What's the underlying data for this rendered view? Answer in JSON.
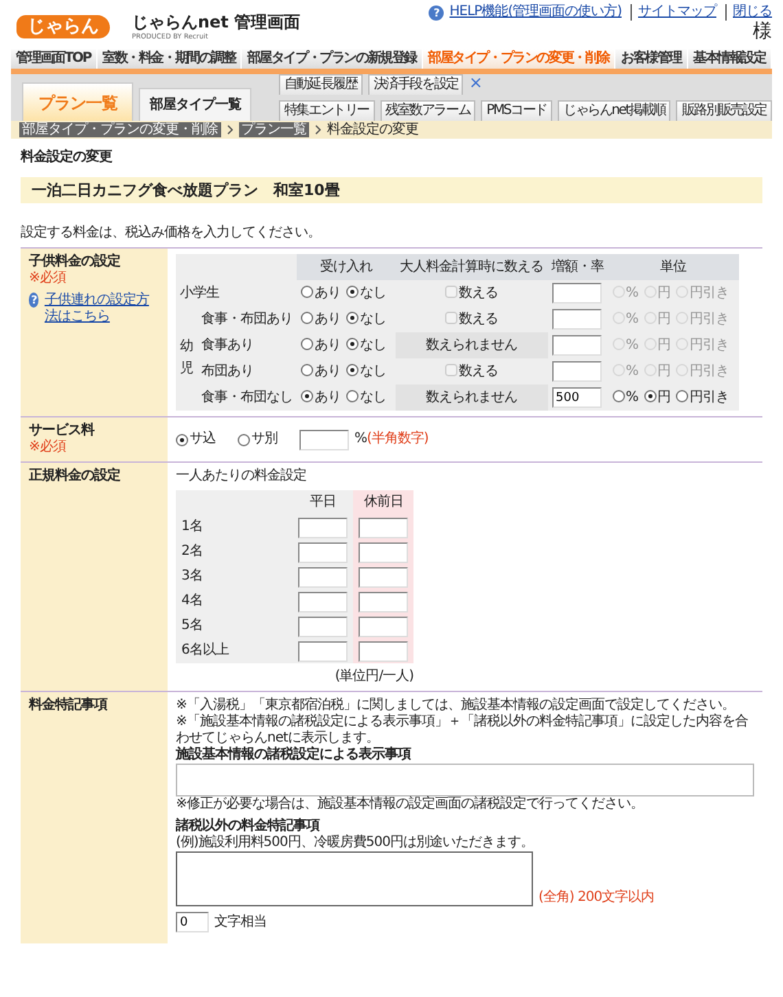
{
  "header": {
    "logo": "じゃらん",
    "title": "じゃらんnet 管理画面",
    "produced_by": "PRODUCED BY Recruit",
    "help_icon": "?",
    "links": [
      "HELP機能(管理画面の使い方)",
      "サイトマップ",
      "閉じる"
    ],
    "user_suffix": "様"
  },
  "main_nav": [
    {
      "label": "管理画面TOP",
      "selected": false
    },
    {
      "label": "室数・料金・期間の調整",
      "selected": false
    },
    {
      "label": "部屋タイプ・プランの新規登録",
      "selected": false
    },
    {
      "label": "部屋タイプ・プランの変更・削除",
      "selected": true
    },
    {
      "label": "お客様管理",
      "selected": false
    },
    {
      "label": "基本情報設定",
      "selected": false
    }
  ],
  "sub_tabs": [
    {
      "label": "プラン一覧",
      "selected": true
    },
    {
      "label": "部屋タイプ一覧",
      "selected": false
    }
  ],
  "sub_buttons_top": [
    "自動延長履歴",
    "決済手段を設定"
  ],
  "sub_close": "×",
  "sub_buttons_bottom": [
    "特集エントリー",
    "残室数アラーム",
    "PMSコード",
    "じゃらんnet掲載順",
    "販路別販売設定"
  ],
  "breadcrumb": [
    {
      "label": "部屋タイプ・プランの変更・削除",
      "kind": "link"
    },
    {
      "label": "プラン一覧",
      "kind": "link"
    },
    {
      "label": "料金設定の変更",
      "kind": "current"
    }
  ],
  "page_heading": "料金設定の変更",
  "plan_name": "一泊二日カニフグ食べ放題プラン　和室10畳",
  "tax_note": "設定する料金は、税込み価格を入力してください。",
  "child_fee": {
    "label": "子供料金の設定",
    "required": "※必須",
    "help_link": "子供連れの設定方法はこちら",
    "columns": [
      "受け入れ",
      "大人料金計算時に数える",
      "増額・率",
      "単位"
    ],
    "rows": [
      {
        "kind": "row",
        "label": "小学生",
        "accept": [
          {
            "label": "あり",
            "selected": false
          },
          {
            "label": "なし",
            "selected": true
          }
        ],
        "count": {
          "kind": "checkbox",
          "label": "数える",
          "checked": false
        },
        "units_disabled": true,
        "units": [
          {
            "label": "%",
            "selected": false
          },
          {
            "label": "円",
            "selected": false
          },
          {
            "label": "円引き",
            "selected": false
          }
        ]
      },
      {
        "kind": "group",
        "label": "幼児",
        "children": [
          {
            "label": "食事・布団あり",
            "accept": [
              {
                "label": "あり",
                "selected": false
              },
              {
                "label": "なし",
                "selected": true
              }
            ],
            "count": {
              "kind": "checkbox",
              "label": "数える",
              "checked": false
            },
            "units_disabled": true,
            "units": [
              {
                "label": "%",
                "selected": false
              },
              {
                "label": "円",
                "selected": false
              },
              {
                "label": "円引き",
                "selected": false
              }
            ]
          },
          {
            "label": "食事あり",
            "accept": [
              {
                "label": "あり",
                "selected": false
              },
              {
                "label": "なし",
                "selected": true
              }
            ],
            "count": {
              "kind": "text",
              "label": "数えられません"
            },
            "units_disabled": true,
            "units": [
              {
                "label": "%",
                "selected": false
              },
              {
                "label": "円",
                "selected": false
              },
              {
                "label": "円引き",
                "selected": false
              }
            ]
          },
          {
            "label": "布団あり",
            "accept": [
              {
                "label": "あり",
                "selected": false
              },
              {
                "label": "なし",
                "selected": true
              }
            ],
            "count": {
              "kind": "checkbox",
              "label": "数える",
              "checked": false
            },
            "units_disabled": true,
            "units": [
              {
                "label": "%",
                "selected": false
              },
              {
                "label": "円",
                "selected": false
              },
              {
                "label": "円引き",
                "selected": false
              }
            ]
          },
          {
            "label": "食事・布団なし",
            "accept": [
              {
                "label": "あり",
                "selected": true
              },
              {
                "label": "なし",
                "selected": false
              }
            ],
            "count": {
              "kind": "text",
              "label": "数えられません"
            },
            "value": "500",
            "units_disabled": false,
            "units": [
              {
                "label": "%",
                "selected": false
              },
              {
                "label": "円",
                "selected": true
              },
              {
                "label": "円引き",
                "selected": false
              }
            ]
          }
        ]
      }
    ]
  },
  "service_fee": {
    "label": "サービス料",
    "required": "※必須",
    "options": [
      {
        "label": "サ込",
        "selected": true
      },
      {
        "label": "サ別",
        "selected": false
      }
    ],
    "unit": "%",
    "hint": "(半角数字)"
  },
  "regular_fee": {
    "label": "正規料金の設定",
    "subtitle": "一人あたりの料金設定",
    "columns": [
      "平日",
      "休前日"
    ],
    "rows": [
      "1名",
      "2名",
      "3名",
      "4名",
      "5名",
      "6名以上"
    ],
    "unit_note": "(単位円/一人)"
  },
  "fee_notes": {
    "label": "料金特記事項",
    "notes": [
      "※「入湯税」「東京都宿泊税」に関しましては、施設基本情報の設定画面で設定してください。",
      "※「施設基本情報の諸税設定による表示事項」＋「諸税以外の料金特記事項」に設定した内容を合わせてじゃらんnetに表示します。"
    ],
    "tax_heading": "施設基本情報の諸税設定による表示事項",
    "tax_hint": "※修正が必要な場合は、施設基本情報の設定画面の諸税設定で行ってください。",
    "other_heading": "諸税以外の料金特記事項",
    "other_example": "(例)施設利用料500円、冷暖房費500円は別途いただきます。",
    "limit": "(全角) 200文字以内",
    "count": "0",
    "count_suffix": "文字相当"
  }
}
